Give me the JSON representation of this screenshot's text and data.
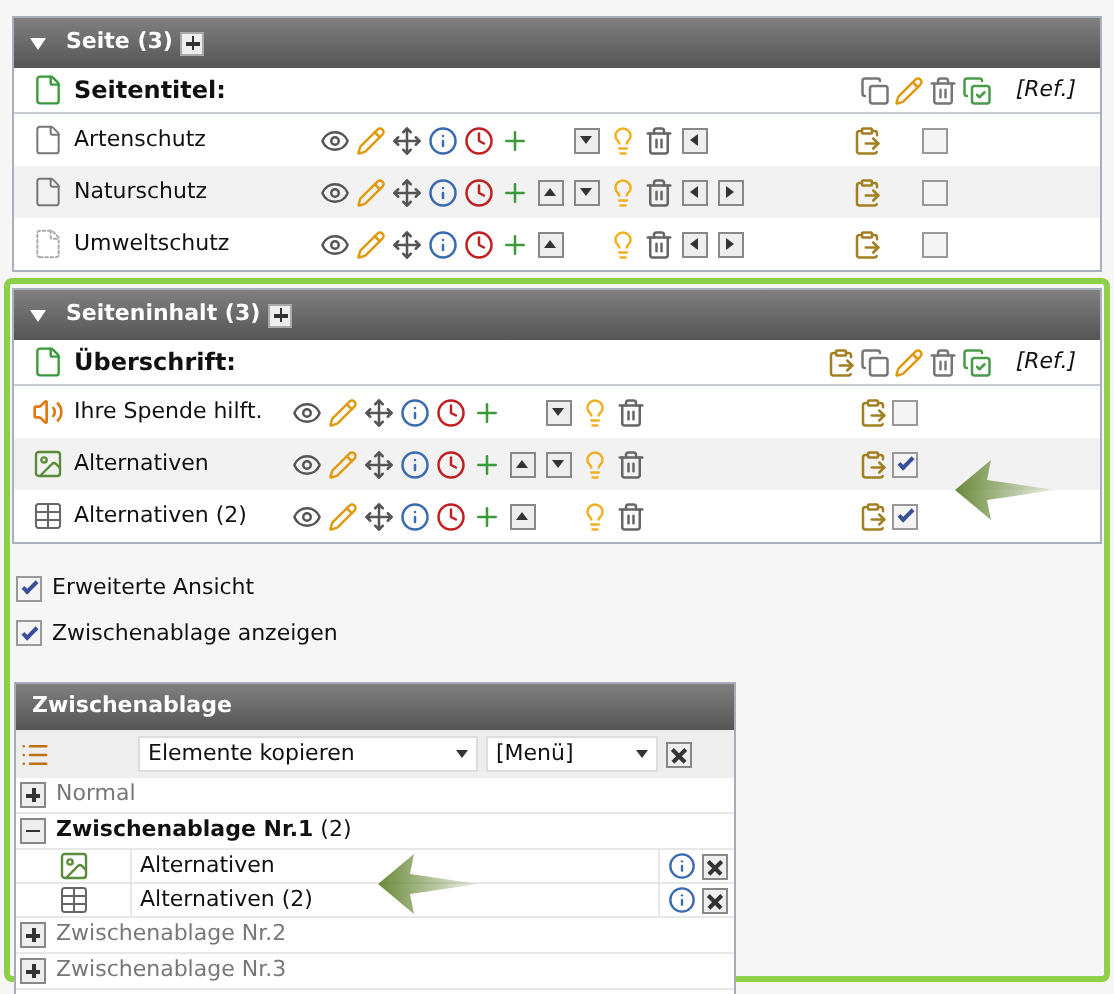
{
  "sections": [
    {
      "title": "Seite (3)",
      "expanded": true,
      "header_label": "Seitentitel:",
      "header_paste": false,
      "ref": "[Ref.]",
      "rows": [
        {
          "name": "Artenschutz",
          "kind": "page",
          "move_up": false,
          "move_down": true,
          "move_left": true,
          "move_right": false,
          "checked": false
        },
        {
          "name": "Naturschutz",
          "kind": "page",
          "move_up": true,
          "move_down": true,
          "move_left": true,
          "move_right": true,
          "checked": false
        },
        {
          "name": "Umweltschutz",
          "kind": "page-hidden",
          "move_up": true,
          "move_down": false,
          "move_left": true,
          "move_right": true,
          "checked": false
        }
      ]
    },
    {
      "title": "Seiteninhalt (3)",
      "expanded": true,
      "header_label": "Überschrift:",
      "header_paste": true,
      "ref": "[Ref.]",
      "rows": [
        {
          "name": "Ihre Spende hilft.",
          "kind": "media",
          "move_up": false,
          "move_down": true,
          "move_left": false,
          "move_right": false,
          "checked": false
        },
        {
          "name": "Alternativen",
          "kind": "textpic",
          "move_up": true,
          "move_down": true,
          "move_left": false,
          "move_right": false,
          "checked": true
        },
        {
          "name": "Alternativen (2)",
          "kind": "table",
          "move_up": true,
          "move_down": false,
          "move_left": false,
          "move_right": false,
          "checked": true
        }
      ]
    }
  ],
  "options": [
    {
      "label": "Erweiterte Ansicht",
      "checked": true
    },
    {
      "label": "Zwischenablage anzeigen",
      "checked": true
    }
  ],
  "clipboard": {
    "title": "Zwischenablage",
    "mode_select": "Elemente kopieren",
    "menu_select": "[Menü]",
    "pads": [
      {
        "label": "Normal",
        "expanded": false,
        "selected": false
      },
      {
        "label": "Zwischenablage Nr.1",
        "count": "(2)",
        "expanded": true,
        "selected": true,
        "items": [
          {
            "name": "Alternativen",
            "kind": "textpic"
          },
          {
            "name": "Alternativen (2)",
            "kind": "table"
          }
        ]
      },
      {
        "label": "Zwischenablage Nr.2",
        "expanded": false,
        "selected": false
      },
      {
        "label": "Zwischenablage Nr.3",
        "expanded": false,
        "selected": false
      }
    ]
  }
}
